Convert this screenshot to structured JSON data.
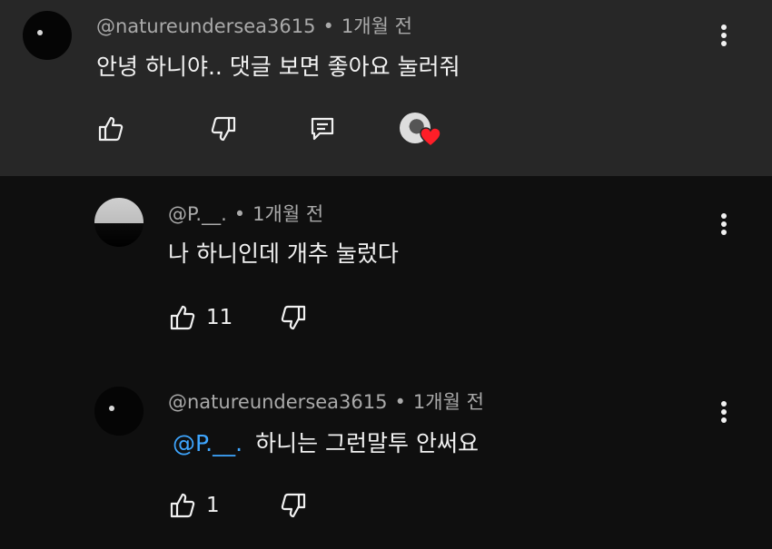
{
  "comments": [
    {
      "author": "@natureundersea3615",
      "separator": "•",
      "time": "1개월 전",
      "text": "안녕 하니야.. 댓글 보면 좋아요 눌러줘",
      "likes": "",
      "actions": {
        "like_icon": "thumb-up-icon",
        "dislike_icon": "thumb-down-icon",
        "reply_icon": "reply-icon",
        "creator_heart": "creator-heart-avatar"
      }
    },
    {
      "author": "@P.__.",
      "separator": "•",
      "time": "1개월 전",
      "text": "나 하니인데 개추 눌렀다",
      "likes": "11"
    },
    {
      "author": "@natureundersea3615",
      "separator": "•",
      "time": "1개월 전",
      "mention": "@P.__.",
      "text": "하니는 그런말투 안써요",
      "likes": "1"
    }
  ],
  "colors": {
    "background": "#0f0f0f",
    "highlight_bg": "#272727",
    "mention": "#3ea6ff",
    "heart": "#ff1e28",
    "meta": "#aaaaaa"
  }
}
